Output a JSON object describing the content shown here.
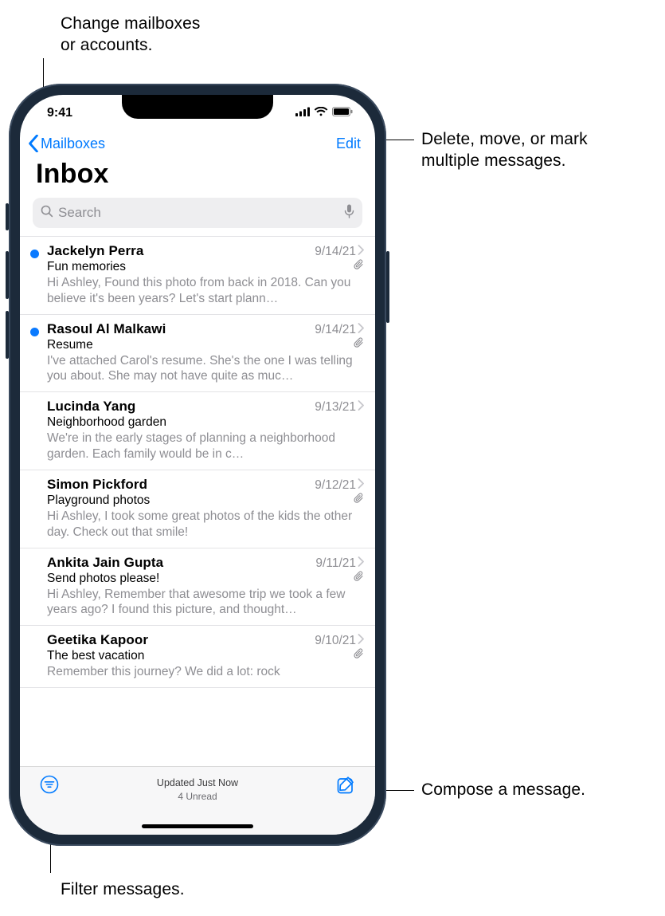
{
  "callouts": {
    "mailboxes": "Change mailboxes\nor accounts.",
    "edit": "Delete, move, or mark\nmultiple messages.",
    "compose": "Compose a message.",
    "filter": "Filter messages."
  },
  "statusbar": {
    "time": "9:41"
  },
  "nav": {
    "back": "Mailboxes",
    "edit": "Edit"
  },
  "title": "Inbox",
  "search": {
    "placeholder": "Search"
  },
  "messages": [
    {
      "unread": true,
      "sender": "Jackelyn Perra",
      "date": "9/14/21",
      "attachment": true,
      "subject": "Fun memories",
      "preview": "Hi Ashley, Found this photo from back in 2018. Can you believe it's been years? Let's start plann…"
    },
    {
      "unread": true,
      "sender": "Rasoul Al Malkawi",
      "date": "9/14/21",
      "attachment": true,
      "subject": "Resume",
      "preview": "I've attached Carol's resume. She's the one I was telling you about. She may not have quite as muc…"
    },
    {
      "unread": false,
      "sender": "Lucinda Yang",
      "date": "9/13/21",
      "attachment": false,
      "subject": "Neighborhood garden",
      "preview": "We're in the early stages of planning a neighborhood garden. Each family would be in c…"
    },
    {
      "unread": false,
      "sender": "Simon Pickford",
      "date": "9/12/21",
      "attachment": true,
      "subject": "Playground photos",
      "preview": "Hi Ashley, I took some great photos of the kids the other day. Check out that smile!"
    },
    {
      "unread": false,
      "sender": "Ankita Jain Gupta",
      "date": "9/11/21",
      "attachment": true,
      "subject": "Send photos please!",
      "preview": "Hi Ashley, Remember that awesome trip we took a few years ago? I found this picture, and thought…"
    },
    {
      "unread": false,
      "sender": "Geetika Kapoor",
      "date": "9/10/21",
      "attachment": true,
      "subject": "The best vacation",
      "preview": "Remember this journey? We did a lot: rock"
    }
  ],
  "toolbar": {
    "status1": "Updated Just Now",
    "status2": "4 Unread"
  }
}
